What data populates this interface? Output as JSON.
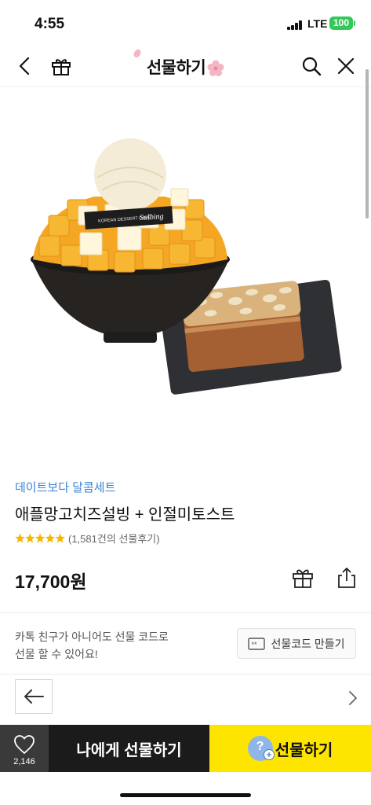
{
  "status_bar": {
    "time": "4:55",
    "network": "LTE",
    "battery": "100"
  },
  "header": {
    "title": "선물하기"
  },
  "product": {
    "category": "데이트보다 달콤세트",
    "name": "애플망고치즈설빙 + 인절미토스트",
    "rating_stars": 5,
    "review_text": "(1,581건의 선물후기)",
    "price": "17,700원",
    "image_label": "Sulbing",
    "image_sublabel": "KOREAN DESSERT CAFE"
  },
  "gift_code": {
    "line1": "카톡 친구가 아니어도 선물 코드로",
    "line2": "선물 할 수 있어요!",
    "button_label": "선물코드 만들기"
  },
  "bottom_bar": {
    "like_count": "2,146",
    "self_gift_label": "나에게 선물하기",
    "gift_label": "선물하기",
    "help_icon_text": "?"
  },
  "colors": {
    "accent_blue": "#3a82d6",
    "star": "#f5b700",
    "kakao_yellow": "#fee500",
    "dark": "#1b1b1b"
  }
}
